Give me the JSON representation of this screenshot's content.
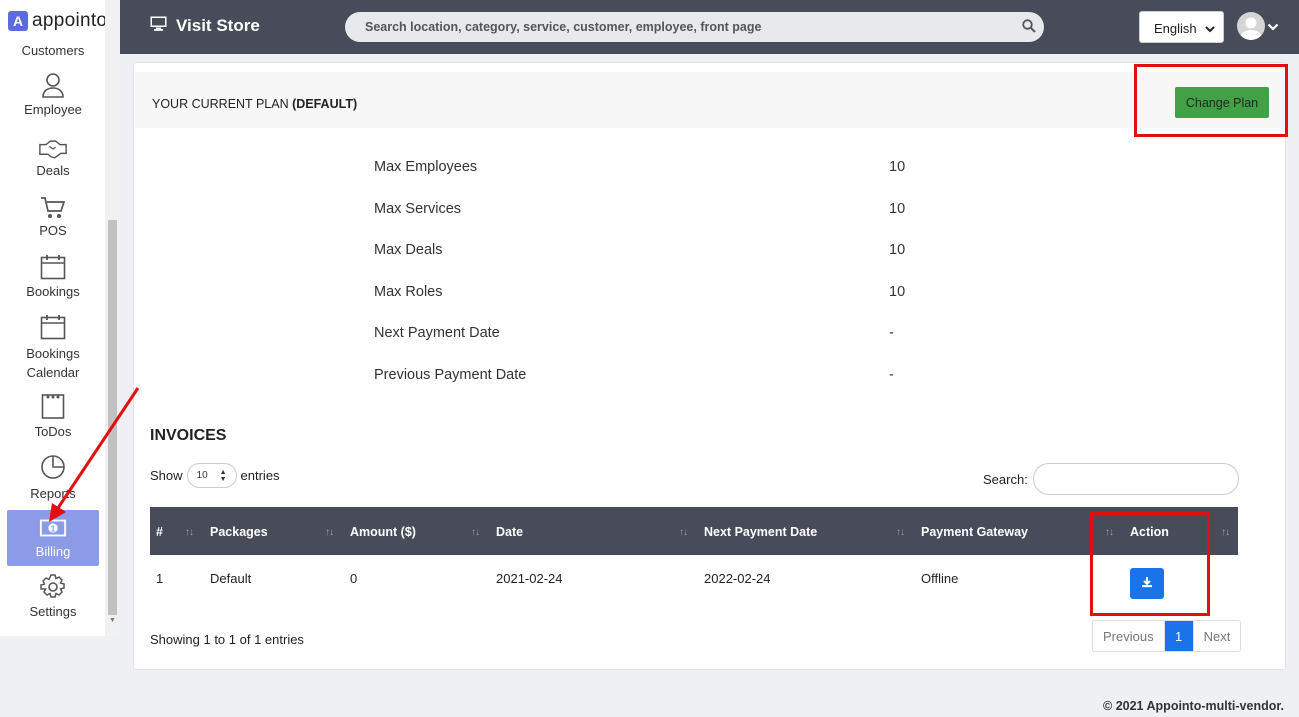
{
  "brand": {
    "name": "appointo",
    "mark": "A"
  },
  "sidebar": {
    "top_label": "Customers",
    "items": [
      {
        "label": "Employee",
        "icon": "user-icon"
      },
      {
        "label": "Deals",
        "icon": "handshake-icon"
      },
      {
        "label": "POS",
        "icon": "cart-icon"
      },
      {
        "label": "Bookings",
        "icon": "calendar-icon"
      },
      {
        "label_line1": "Bookings",
        "label_line2": "Calendar",
        "icon": "calendar-icon"
      },
      {
        "label": "ToDos",
        "icon": "notepad-icon"
      },
      {
        "label": "Reports",
        "icon": "pie-chart-icon"
      },
      {
        "label": "Billing",
        "icon": "money-icon",
        "active": true
      },
      {
        "label": "Settings",
        "icon": "gear-icon"
      }
    ]
  },
  "topbar": {
    "visit_store": "Visit Store",
    "search_placeholder": "Search location, category, service, customer, employee, front page",
    "language": "English"
  },
  "plan": {
    "title_prefix": "YOUR CURRENT PLAN ",
    "title_name": "(DEFAULT)",
    "change_button": "Change Plan",
    "limits": [
      {
        "label": "Max Employees",
        "value": "10"
      },
      {
        "label": "Max Services",
        "value": "10"
      },
      {
        "label": "Max Deals",
        "value": "10"
      },
      {
        "label": "Max Roles",
        "value": "10"
      },
      {
        "label": "Next Payment Date",
        "value": "-"
      },
      {
        "label": "Previous Payment Date",
        "value": "-"
      }
    ]
  },
  "invoices": {
    "title": "INVOICES",
    "show": "Show",
    "entries_value": "10",
    "entries": "entries",
    "search_label": "Search:",
    "columns": [
      "#",
      "Packages",
      "Amount ($)",
      "Date",
      "Next Payment Date",
      "Payment Gateway",
      "Action"
    ],
    "rows": [
      {
        "num": "1",
        "package": "Default",
        "amount": "0",
        "date": "2021-02-24",
        "next_payment": "2022-02-24",
        "gateway": "Offline"
      }
    ],
    "showing": "Showing 1 to 1 of 1 entries",
    "pager": {
      "previous": "Previous",
      "page": "1",
      "next": "Next"
    }
  },
  "footer": "© 2021 Appointo-multi-vendor.",
  "colors": {
    "topbar": "#484c5a",
    "accent_green": "#43a047",
    "accent_blue": "#1a73e8",
    "sidebar_active": "#8c9be6",
    "highlight_red": "#e01010"
  }
}
